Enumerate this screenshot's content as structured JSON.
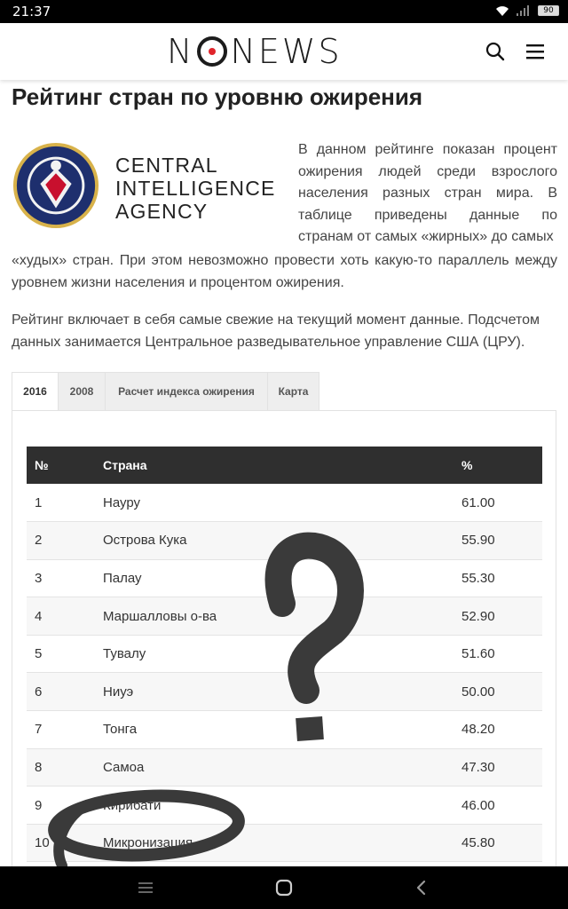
{
  "status_bar": {
    "time": "21:37",
    "battery": "90"
  },
  "header": {
    "logo": "NONEWS"
  },
  "article": {
    "title": "Рейтинг стран по уровню ожирения",
    "cia_logo_lines": [
      "CENTRAL",
      "INTELLIGENCE",
      "AGENCY"
    ],
    "intro_right": "В данном рейтинге показан процент ожирения людей среди взрослого населения разных стран мира. В таблице приведены данные по странам от самых «жирных» до самых",
    "intro_full": "«худых» стран. При этом невозможно провести хоть какую-то параллель между уровнем жизни населения и процентом ожирения.",
    "para2": "Рейтинг включает в себя самые свежие на текущий момент данные. Подсчетом данных занимается Центральное разведывательное управление США (ЦРУ)."
  },
  "tabs": [
    {
      "label": "2016",
      "active": true
    },
    {
      "label": "2008",
      "active": false
    },
    {
      "label": "Расчет индекса ожирения",
      "active": false
    },
    {
      "label": "Карта",
      "active": false
    }
  ],
  "table": {
    "headers": {
      "num": "№",
      "country": "Страна",
      "percent": "%"
    },
    "rows": [
      {
        "num": "1",
        "country": "Науру",
        "percent": "61.00"
      },
      {
        "num": "2",
        "country": "Острова Кука",
        "percent": "55.90"
      },
      {
        "num": "3",
        "country": "Палау",
        "percent": "55.30"
      },
      {
        "num": "4",
        "country": "Маршалловы о-ва",
        "percent": "52.90"
      },
      {
        "num": "5",
        "country": "Тувалу",
        "percent": "51.60"
      },
      {
        "num": "6",
        "country": "Ниуэ",
        "percent": "50.00"
      },
      {
        "num": "7",
        "country": "Тонга",
        "percent": "48.20"
      },
      {
        "num": "8",
        "country": "Самоа",
        "percent": "47.30"
      },
      {
        "num": "9",
        "country": "Кирибати",
        "percent": "46.00"
      },
      {
        "num": "10",
        "country": "Микронизация",
        "percent": "45.80"
      }
    ]
  },
  "colors": {
    "header_bg": "#2f2f2f",
    "logo_red": "#e0242b",
    "scribble": "#3a3a3a"
  },
  "icons": [
    "wifi-icon",
    "signal-icon",
    "battery-icon",
    "search-icon",
    "menu-icon",
    "nav-menu-icon",
    "nav-home-icon",
    "nav-back-icon",
    "cia-seal-icon"
  ]
}
